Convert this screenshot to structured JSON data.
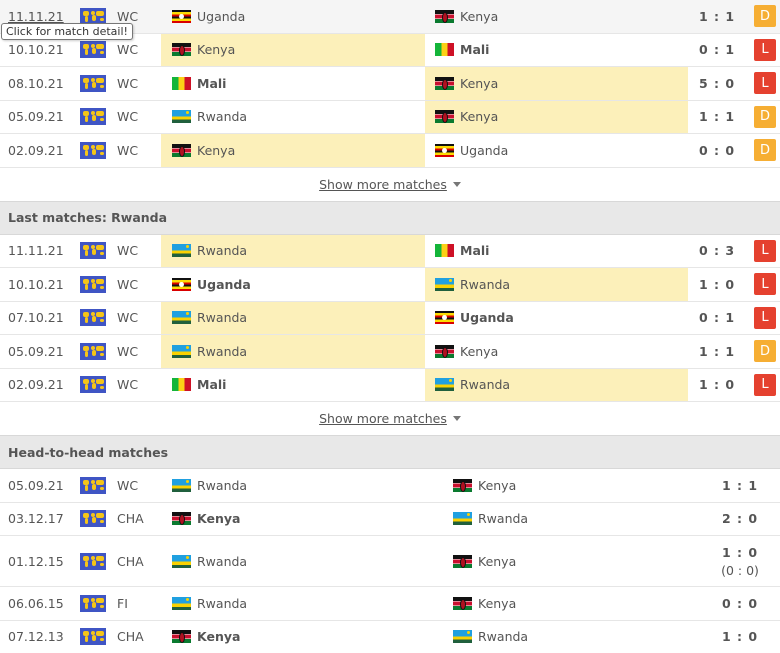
{
  "tooltip": "Click for match detail!",
  "show_more_label": "Show more matches",
  "colors": {
    "draw": "#f6ae33",
    "loss": "#e5412f",
    "highlight": "#fcf0ba",
    "section_bg": "#e8e8e8"
  },
  "sections": [
    {
      "title": "",
      "rows": [
        {
          "date": "11.11.21",
          "comp": "WC",
          "home": "Uganda",
          "home_flag": "uganda",
          "away": "Kenya",
          "away_flag": "kenya",
          "score": "1 : 1",
          "result": "D",
          "highlight": "none",
          "home_bold": false,
          "away_bold": false,
          "hover": true
        },
        {
          "date": "10.10.21",
          "comp": "WC",
          "home": "Kenya",
          "home_flag": "kenya",
          "away": "Mali",
          "away_flag": "mali",
          "score": "0 : 1",
          "result": "L",
          "highlight": "home",
          "home_bold": false,
          "away_bold": true
        },
        {
          "date": "08.10.21",
          "comp": "WC",
          "home": "Mali",
          "home_flag": "mali",
          "away": "Kenya",
          "away_flag": "kenya",
          "score": "5 : 0",
          "result": "L",
          "highlight": "away",
          "home_bold": true,
          "away_bold": false
        },
        {
          "date": "05.09.21",
          "comp": "WC",
          "home": "Rwanda",
          "home_flag": "rwanda",
          "away": "Kenya",
          "away_flag": "kenya",
          "score": "1 : 1",
          "result": "D",
          "highlight": "away",
          "home_bold": false,
          "away_bold": false
        },
        {
          "date": "02.09.21",
          "comp": "WC",
          "home": "Kenya",
          "home_flag": "kenya",
          "away": "Uganda",
          "away_flag": "uganda",
          "score": "0 : 0",
          "result": "D",
          "highlight": "home",
          "home_bold": false,
          "away_bold": false
        }
      ]
    },
    {
      "title": "Last matches: Rwanda",
      "rows": [
        {
          "date": "11.11.21",
          "comp": "WC",
          "home": "Rwanda",
          "home_flag": "rwanda",
          "away": "Mali",
          "away_flag": "mali",
          "score": "0 : 3",
          "result": "L",
          "highlight": "home",
          "home_bold": false,
          "away_bold": true
        },
        {
          "date": "10.10.21",
          "comp": "WC",
          "home": "Uganda",
          "home_flag": "uganda",
          "away": "Rwanda",
          "away_flag": "rwanda",
          "score": "1 : 0",
          "result": "L",
          "highlight": "away",
          "home_bold": true,
          "away_bold": false
        },
        {
          "date": "07.10.21",
          "comp": "WC",
          "home": "Rwanda",
          "home_flag": "rwanda",
          "away": "Uganda",
          "away_flag": "uganda",
          "score": "0 : 1",
          "result": "L",
          "highlight": "home",
          "home_bold": false,
          "away_bold": true
        },
        {
          "date": "05.09.21",
          "comp": "WC",
          "home": "Rwanda",
          "home_flag": "rwanda",
          "away": "Kenya",
          "away_flag": "kenya",
          "score": "1 : 1",
          "result": "D",
          "highlight": "home",
          "home_bold": false,
          "away_bold": false
        },
        {
          "date": "02.09.21",
          "comp": "WC",
          "home": "Mali",
          "home_flag": "mali",
          "away": "Rwanda",
          "away_flag": "rwanda",
          "score": "1 : 0",
          "result": "L",
          "highlight": "away",
          "home_bold": true,
          "away_bold": false
        }
      ]
    },
    {
      "title": "Head-to-head matches",
      "h2h": true,
      "rows": [
        {
          "date": "05.09.21",
          "comp": "WC",
          "home": "Rwanda",
          "home_flag": "rwanda",
          "away": "Kenya",
          "away_flag": "kenya",
          "score": "1 : 1",
          "home_bold": false,
          "away_bold": false
        },
        {
          "date": "03.12.17",
          "comp": "CHA",
          "home": "Kenya",
          "home_flag": "kenya",
          "away": "Rwanda",
          "away_flag": "rwanda",
          "score": "2 : 0",
          "home_bold": true,
          "away_bold": false
        },
        {
          "date": "01.12.15",
          "comp": "CHA",
          "home": "Rwanda",
          "home_flag": "rwanda",
          "away": "Kenya",
          "away_flag": "kenya",
          "score": "1 : 0",
          "score_ht": "(0 : 0)",
          "home_bold": false,
          "away_bold": false
        },
        {
          "date": "06.06.15",
          "comp": "FI",
          "home": "Rwanda",
          "home_flag": "rwanda",
          "away": "Kenya",
          "away_flag": "kenya",
          "score": "0 : 0",
          "home_bold": false,
          "away_bold": false
        },
        {
          "date": "07.12.13",
          "comp": "CHA",
          "home": "Kenya",
          "home_flag": "kenya",
          "away": "Rwanda",
          "away_flag": "rwanda",
          "score": "1 : 0",
          "home_bold": true,
          "away_bold": false
        }
      ]
    }
  ]
}
